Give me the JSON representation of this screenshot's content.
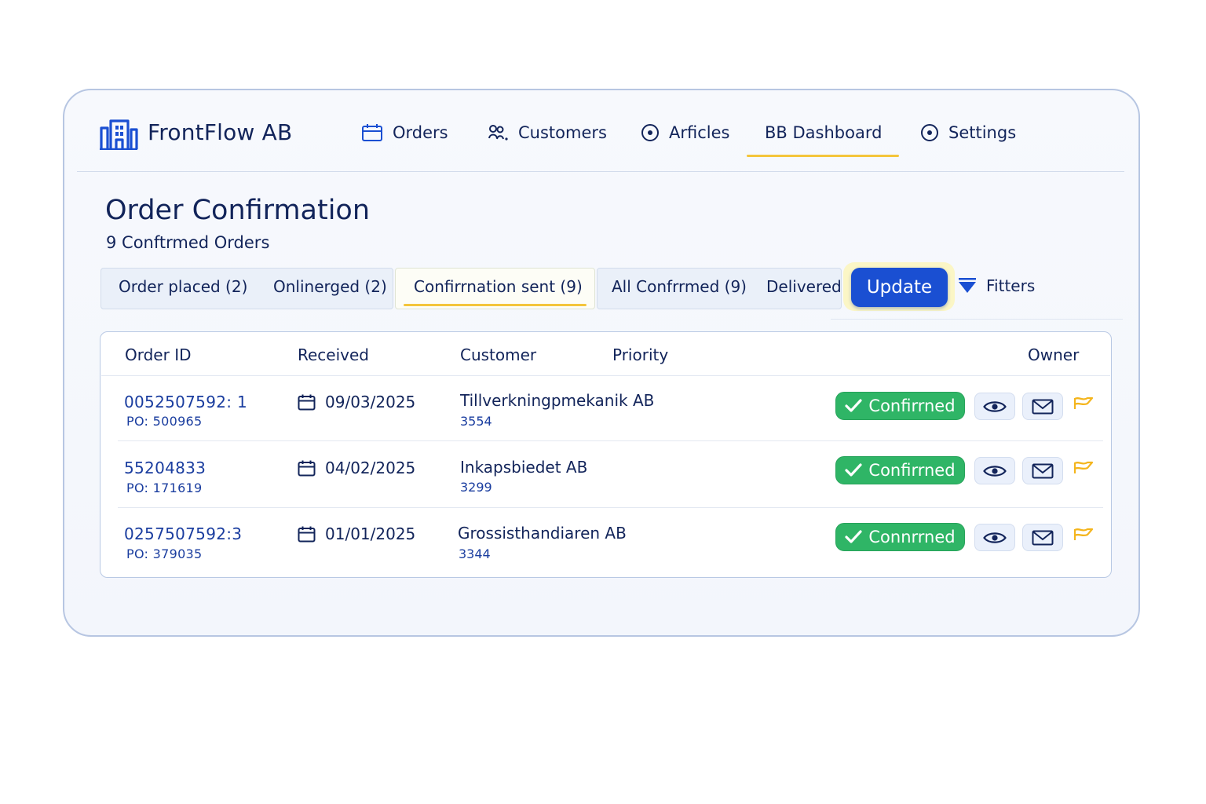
{
  "app": {
    "brand": "FrontFlow AB"
  },
  "nav": {
    "orders": "Orders",
    "customers": "Customers",
    "articles": "Arficles",
    "dashboard": "BB Dashboard",
    "settings": "Settings",
    "active": "BB Dashboard"
  },
  "page": {
    "title": "Order Confirmation",
    "subtitle": "9 Conftrmed Orders"
  },
  "tabs": {
    "order_placed": "Order placed (2)",
    "onlinerged": "Onlinerged (2)",
    "confirmation_sent": "Confirrnation sent (9)",
    "all_confirmed": "All Confrrmed (9)",
    "delivered": "Delivered",
    "active": "Confirrnation sent (9)"
  },
  "actions": {
    "update": "Update",
    "filters": "Fitters"
  },
  "table": {
    "headers": {
      "order_id": "Order ID",
      "received": "Received",
      "customer": "Customer",
      "priority": "Priority",
      "owner": "Owner"
    },
    "rows": [
      {
        "order_id": "0052507592: 1",
        "po": "PO: 500965",
        "received": "09/03/2025",
        "customer": "Tillverkningpmekanik AB",
        "customer_no": "3554",
        "status": "Confirrned"
      },
      {
        "order_id": "55204833",
        "po": "PO: 171619",
        "received": "04/02/2025",
        "customer": "Inkapsbiedet AB",
        "customer_no": "3299",
        "status": "Confirrned"
      },
      {
        "order_id": "0257507592:3",
        "po": "PO: 379035",
        "received": "01/01/2025",
        "customer": "Grossisthandiaren AB",
        "customer_no": "3344",
        "status": "Connrrned"
      }
    ]
  },
  "colors": {
    "primary": "#1a4fd2",
    "accent": "#f4c53b",
    "success": "#2fb566",
    "text": "#12245a"
  },
  "icons": [
    "building-logo-icon",
    "calendar-icon",
    "customers-icon",
    "target-icon",
    "settings-icon",
    "filter-icon",
    "check-icon",
    "eye-icon",
    "mail-icon",
    "flag-icon"
  ]
}
